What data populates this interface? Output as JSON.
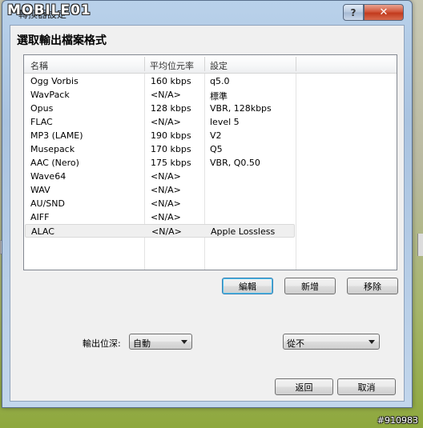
{
  "window": {
    "title": "轉換器設定",
    "logo_text": "MOBILE01",
    "help_glyph": "?",
    "close_glyph": "✕"
  },
  "heading": "選取輸出檔案格式",
  "list": {
    "columns": [
      "名稱",
      "平均位元率",
      "設定"
    ],
    "rows": [
      {
        "name": "Ogg Vorbis",
        "bitrate": "160 kbps",
        "setting": "q5.0"
      },
      {
        "name": "WavPack",
        "bitrate": "<N/A>",
        "setting": "標準"
      },
      {
        "name": "Opus",
        "bitrate": "128 kbps",
        "setting": "VBR, 128kbps"
      },
      {
        "name": "FLAC",
        "bitrate": "<N/A>",
        "setting": "level 5"
      },
      {
        "name": "MP3 (LAME)",
        "bitrate": "190 kbps",
        "setting": "V2"
      },
      {
        "name": "Musepack",
        "bitrate": "170 kbps",
        "setting": "Q5"
      },
      {
        "name": "AAC (Nero)",
        "bitrate": "175 kbps",
        "setting": "VBR, Q0.50"
      },
      {
        "name": "Wave64",
        "bitrate": "<N/A>",
        "setting": ""
      },
      {
        "name": "WAV",
        "bitrate": "<N/A>",
        "setting": ""
      },
      {
        "name": "AU/SND",
        "bitrate": "<N/A>",
        "setting": ""
      },
      {
        "name": "AIFF",
        "bitrate": "<N/A>",
        "setting": ""
      },
      {
        "name": "ALAC",
        "bitrate": "<N/A>",
        "setting": "Apple Lossless",
        "selected": true
      }
    ]
  },
  "buttons": {
    "edit": "編輯",
    "add": "新增",
    "remove": "移除",
    "back": "返回",
    "cancel": "取消"
  },
  "bit_depth": {
    "label": "輸出位深:",
    "value": "自動"
  },
  "dither": {
    "value": "從不"
  },
  "watermark": "#910983"
}
